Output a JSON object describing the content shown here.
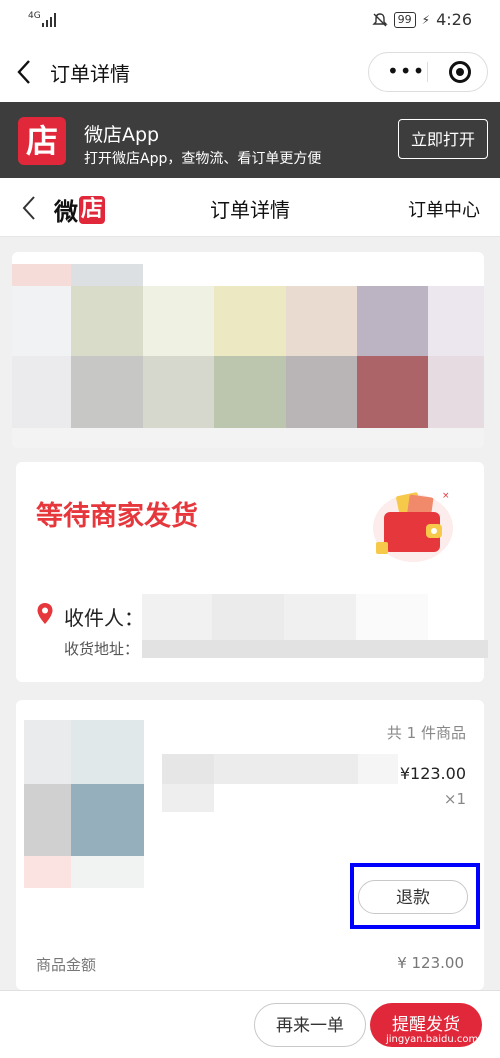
{
  "status_bar": {
    "signal": "4G",
    "battery": "99",
    "time": "4:26"
  },
  "wx_nav": {
    "title": "订单详情"
  },
  "app_banner": {
    "logo_char": "店",
    "app_name": "微店App",
    "description": "打开微店App，查物流、看订单更方便",
    "open_button": "立即打开"
  },
  "page_nav": {
    "logo_text_1": "微",
    "logo_text_2": "店",
    "title": "订单详情",
    "order_center": "订单中心"
  },
  "order_status": {
    "status_text": "等待商家发货",
    "recipient_label": "收件人：",
    "address_label": "收货地址："
  },
  "product": {
    "count_text": "共 1 件商品",
    "price": "¥123.00",
    "quantity": "×1",
    "refund_button": "退款",
    "amount_label": "商品金额",
    "amount_value": "¥ 123.00"
  },
  "bottom_bar": {
    "reorder_button": "再来一单",
    "remind_button": "提醒发货"
  },
  "watermark": "jingyan.baidu.com",
  "colors": {
    "accent": "#e0283a",
    "status_red": "#e6373d",
    "highlight": "#0000ff"
  }
}
